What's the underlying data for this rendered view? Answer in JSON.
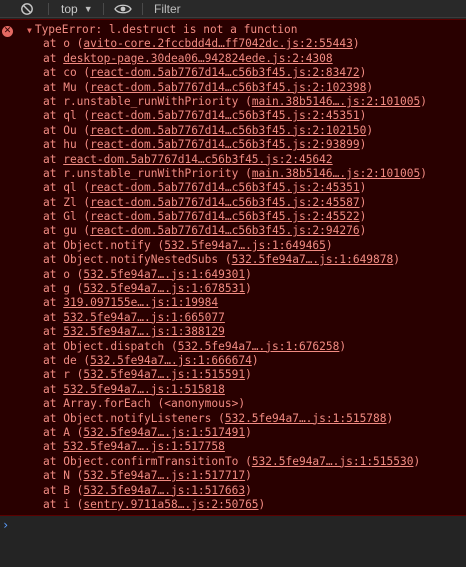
{
  "toolbar": {
    "context": "top",
    "filter_placeholder": "Filter"
  },
  "error": {
    "message": "TypeError: l.destruct is not a function",
    "frames": [
      {
        "prefix": "at o (",
        "link": "avito-core.2fccbdd4d…ff7042dc.js:2:55443",
        "suffix": ")"
      },
      {
        "prefix": "at ",
        "link": "desktop-page.30dea06…942824ede.js:2:4308",
        "suffix": ""
      },
      {
        "prefix": "at co (",
        "link": "react-dom.5ab7767d14…c56b3f45.js:2:83472",
        "suffix": ")"
      },
      {
        "prefix": "at Mu (",
        "link": "react-dom.5ab7767d14…c56b3f45.js:2:102398",
        "suffix": ")"
      },
      {
        "prefix": "at r.unstable_runWithPriority (",
        "link": "main.38b5146….js:2:101005",
        "suffix": ")"
      },
      {
        "prefix": "at ql (",
        "link": "react-dom.5ab7767d14…c56b3f45.js:2:45351",
        "suffix": ")"
      },
      {
        "prefix": "at Ou (",
        "link": "react-dom.5ab7767d14…c56b3f45.js:2:102150",
        "suffix": ")"
      },
      {
        "prefix": "at hu (",
        "link": "react-dom.5ab7767d14…c56b3f45.js:2:93899",
        "suffix": ")"
      },
      {
        "prefix": "at ",
        "link": "react-dom.5ab7767d14…c56b3f45.js:2:45642",
        "suffix": ""
      },
      {
        "prefix": "at r.unstable_runWithPriority (",
        "link": "main.38b5146….js:2:101005",
        "suffix": ")"
      },
      {
        "prefix": "at ql (",
        "link": "react-dom.5ab7767d14…c56b3f45.js:2:45351",
        "suffix": ")"
      },
      {
        "prefix": "at Zl (",
        "link": "react-dom.5ab7767d14…c56b3f45.js:2:45587",
        "suffix": ")"
      },
      {
        "prefix": "at Gl (",
        "link": "react-dom.5ab7767d14…c56b3f45.js:2:45522",
        "suffix": ")"
      },
      {
        "prefix": "at gu (",
        "link": "react-dom.5ab7767d14…c56b3f45.js:2:94276",
        "suffix": ")"
      },
      {
        "prefix": "at Object.notify (",
        "link": "532.5fe94a7….js:1:649465",
        "suffix": ")"
      },
      {
        "prefix": "at Object.notifyNestedSubs (",
        "link": "532.5fe94a7….js:1:649878",
        "suffix": ")"
      },
      {
        "prefix": "at o (",
        "link": "532.5fe94a7….js:1:649301",
        "suffix": ")"
      },
      {
        "prefix": "at g (",
        "link": "532.5fe94a7….js:1:678531",
        "suffix": ")"
      },
      {
        "prefix": "at ",
        "link": "319.097155e….js:1:19984",
        "suffix": ""
      },
      {
        "prefix": "at ",
        "link": "532.5fe94a7….js:1:665077",
        "suffix": ""
      },
      {
        "prefix": "at ",
        "link": "532.5fe94a7….js:1:388129",
        "suffix": ""
      },
      {
        "prefix": "at Object.dispatch (",
        "link": "532.5fe94a7….js:1:676258",
        "suffix": ")"
      },
      {
        "prefix": "at de (",
        "link": "532.5fe94a7….js:1:666674",
        "suffix": ")"
      },
      {
        "prefix": "at r (",
        "link": "532.5fe94a7….js:1:515591",
        "suffix": ")"
      },
      {
        "prefix": "at ",
        "link": "532.5fe94a7….js:1:515818",
        "suffix": ""
      },
      {
        "prefix": "at Array.forEach (<anonymous>)",
        "link": "",
        "suffix": ""
      },
      {
        "prefix": "at Object.notifyListeners (",
        "link": "532.5fe94a7….js:1:515788",
        "suffix": ")"
      },
      {
        "prefix": "at A (",
        "link": "532.5fe94a7….js:1:517491",
        "suffix": ")"
      },
      {
        "prefix": "at ",
        "link": "532.5fe94a7….js:1:517758",
        "suffix": ""
      },
      {
        "prefix": "at Object.confirmTransitionTo (",
        "link": "532.5fe94a7….js:1:515530",
        "suffix": ")"
      },
      {
        "prefix": "at N (",
        "link": "532.5fe94a7….js:1:517717",
        "suffix": ")"
      },
      {
        "prefix": "at B (",
        "link": "532.5fe94a7….js:1:517663",
        "suffix": ")"
      },
      {
        "prefix": "at i (",
        "link": "sentry.9711a58….js:2:50765",
        "suffix": ")"
      }
    ]
  },
  "icons": {
    "error": "error-icon",
    "block": "block-icon",
    "eye": "eye-icon",
    "dropdown": "chevron-down-icon",
    "expand": "triangle-down-icon",
    "prompt": "chevron-right-icon"
  },
  "colors": {
    "error_background": "#290000",
    "error_text": "#f28b82",
    "prompt": "#5a9eff"
  }
}
